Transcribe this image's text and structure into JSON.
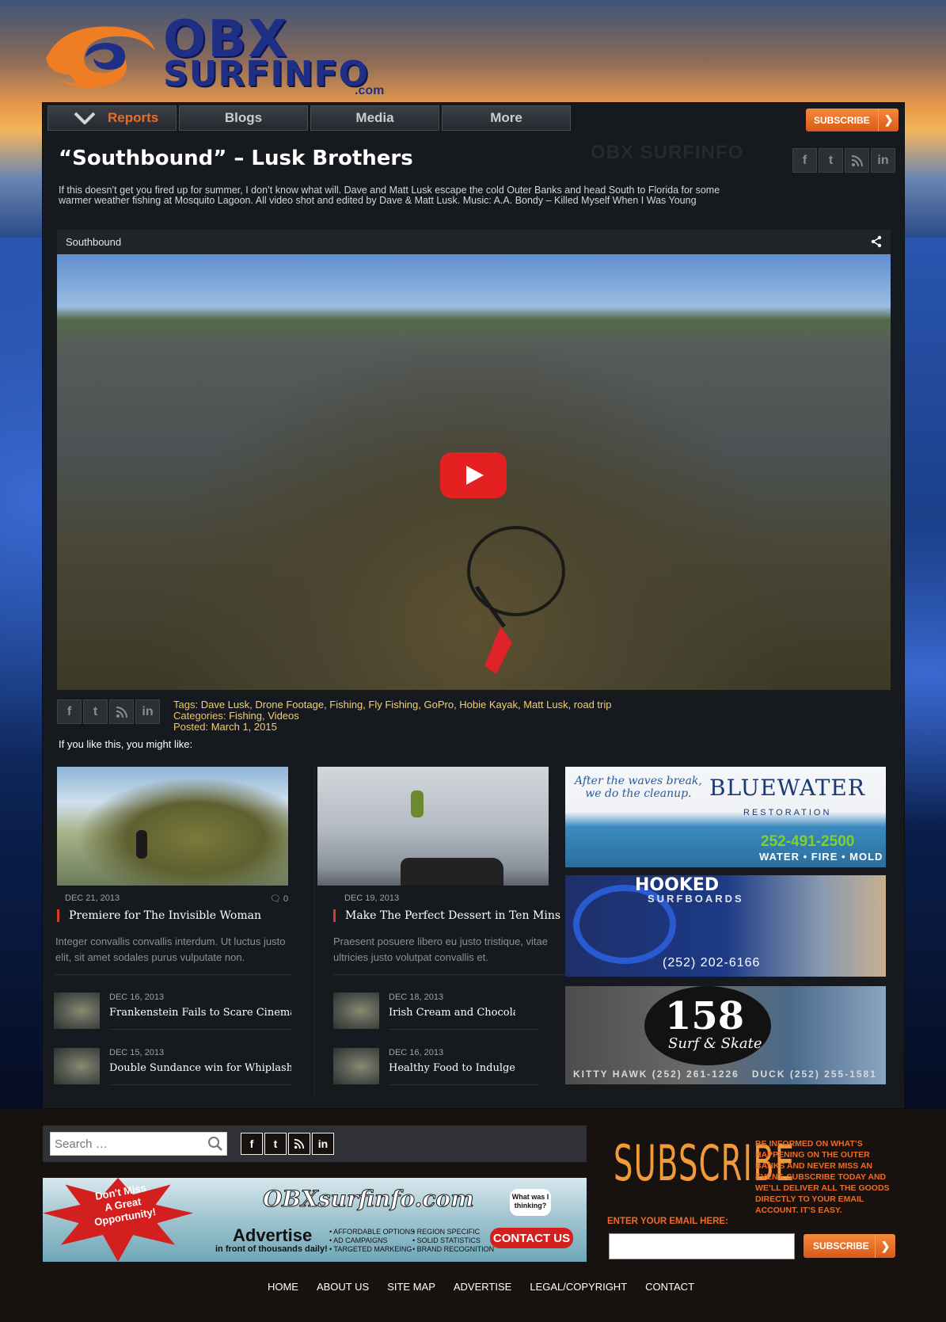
{
  "logo": {
    "line1": "OBX",
    "line2": "SURFINFO",
    "line3": ".com"
  },
  "nav": {
    "items": [
      {
        "label": "Reports"
      },
      {
        "label": "Blogs"
      },
      {
        "label": "Media"
      },
      {
        "label": "More"
      }
    ],
    "subscribe_label": "SUBSCRIBE",
    "watermark": "OBX SURFINFO"
  },
  "post": {
    "title": "“Southbound” – Lusk Brothers",
    "description": "If this doesn’t get you fired up for summer, I don’t know what will. Dave and Matt Lusk escape the cold Outer Banks and head South to Florida for some warmer weather fishing at Mosquito Lagoon. All video shot and edited by Dave & Matt Lusk. Music: A.A. Bondy – Killed Myself When I Was Young",
    "video_title": "Southbound",
    "tags_label": "Tags:",
    "tags": "Dave Lusk, Drone Footage, Fishing, Fly Fishing, GoPro, Hobie Kayak, Matt Lusk, road trip",
    "categories_label": "Categories:",
    "categories": "Fishing, Videos",
    "posted_label": "Posted:",
    "posted": "March 1, 2015",
    "might_like": "If you like this, you might like:"
  },
  "social": {
    "facebook": "f",
    "twitter": "t",
    "rss": "rss",
    "linkedin": "in"
  },
  "related": [
    {
      "date": "DEC 21, 2013",
      "comments": "0",
      "title": "Premiere for The Invisible Woman",
      "excerpt": "Integer convallis convallis interdum. Ut luctus justo elit, sit amet sodales purus vulputate non.",
      "minis": [
        {
          "date": "DEC 16, 2013",
          "title": "Frankenstein Fails to Scare Cinemas"
        },
        {
          "date": "DEC 15, 2013",
          "title": "Double Sundance win for Whiplash"
        }
      ]
    },
    {
      "date": "DEC 19, 2013",
      "title": "Make The Perfect Dessert in Ten Mins",
      "excerpt": "Praesent posuere libero eu justo tristique, vitae ultricies justo volutpat convallis et.",
      "minis": [
        {
          "date": "DEC 18, 2013",
          "title": "Irish Cream and Chocolate Cheesecake"
        },
        {
          "date": "DEC 16, 2013",
          "title": "Healthy Food to Indulge at Home"
        }
      ]
    }
  ],
  "ads": {
    "bluewater": {
      "tagline": "After the waves break,\nwe do the cleanup.",
      "brand": "BLUEWATER",
      "sub": "RESTORATION",
      "phone": "252-491-2500",
      "services": "WATER • FIRE • MOLD"
    },
    "hooked": {
      "brand": "HOOKED",
      "sub": "SURFBOARDS",
      "phone": "(252) 202-6166"
    },
    "skate": {
      "number": "158",
      "name": "Surf & Skate",
      "locations": "KITTY HAWK (252) 261-1226   DUCK (252) 255-1581"
    }
  },
  "footer": {
    "search_placeholder": "Search …",
    "banner": {
      "starburst": "Don't Miss\nA Great\nOpportunity!",
      "site": "OBXsurfinfo.com",
      "headline": "Advertise",
      "subline": "in front of thousands daily!",
      "bullets_left": "• AFFORDABLE OPTIONS\n• AD CAMPAIGNS\n• TARGETED MARKEING",
      "bullets_right": "• REGION SPECIFIC\n• SOLID STATISTICS\n• BRAND RECOGNITION",
      "bubble": "What was I thinking?",
      "cta": "CONTACT US"
    },
    "subscribe_heading": "SUBSCRIBE",
    "subscribe_text": "BE INFORMED ON WHAT’S HAPPENING ON THE OUTER BANKS AND NEVER MISS AN EVENT. SUBSCRIBE TODAY AND WE’LL DELIVER ALL THE GOODS DIRECTLY TO YOUR EMAIL ACCOUNT. IT’S EASY.",
    "email_label": "ENTER YOUR EMAIL HERE:",
    "subscribe_button": "SUBSCRIBE",
    "links": [
      "HOME",
      "ABOUT US",
      "SITE MAP",
      "ADVERTISE",
      "LEGAL/COPYRIGHT",
      "CONTACT"
    ]
  },
  "colors": {
    "accent": "#ef6b24",
    "tag_text": "#f2c55a",
    "panel": "#16191e",
    "footer": "#17120f"
  }
}
